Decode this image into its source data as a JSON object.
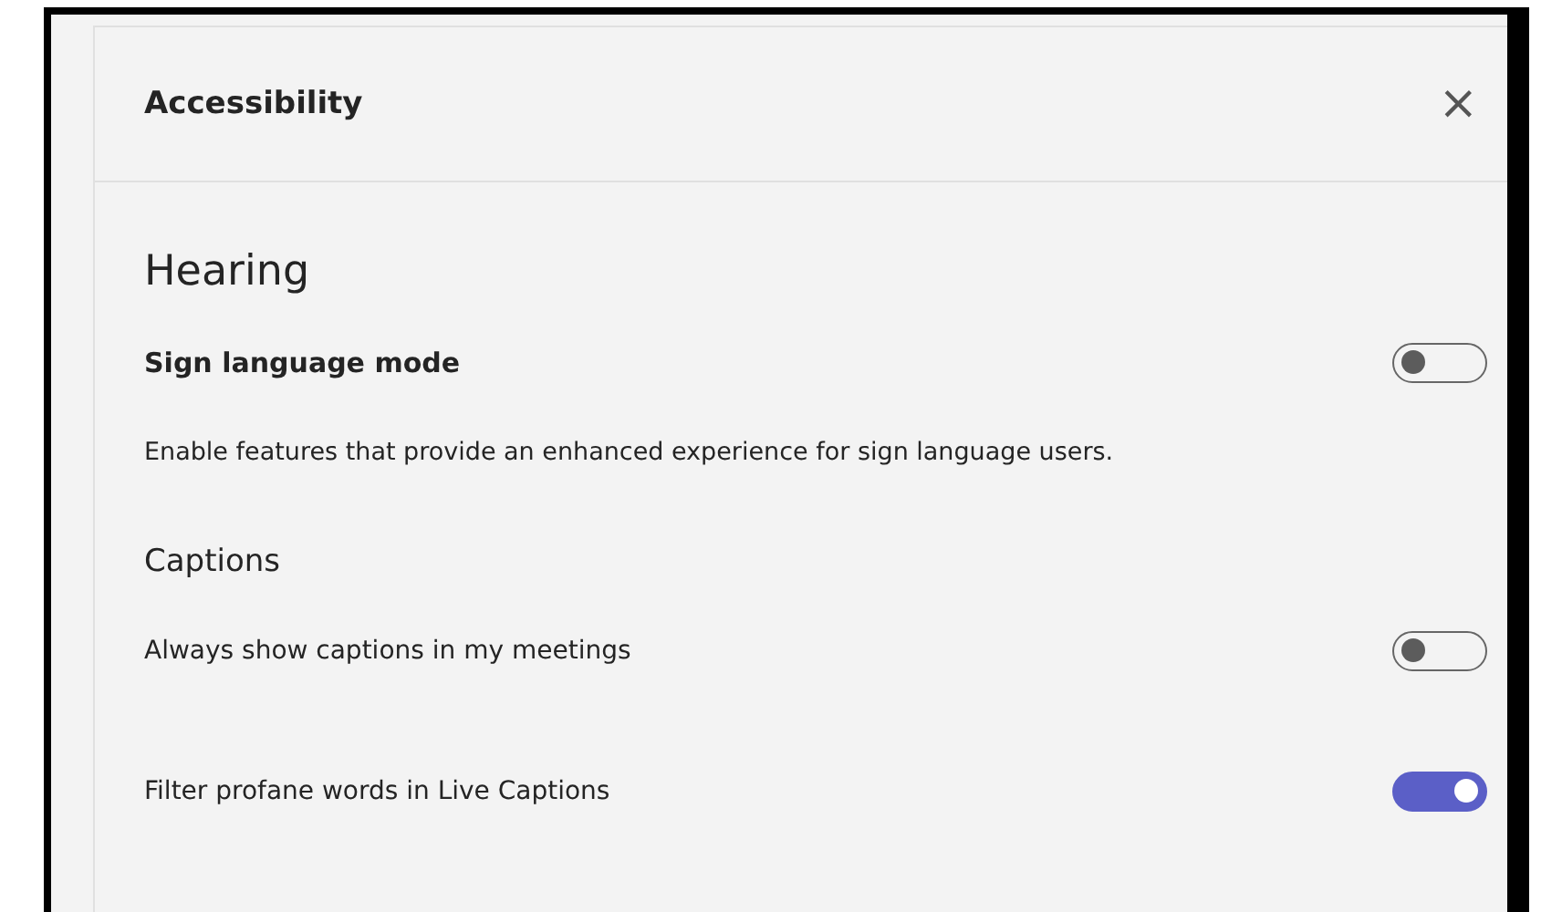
{
  "panel": {
    "title": "Accessibility",
    "close": "×"
  },
  "section": {
    "heading": "Hearing"
  },
  "items": [
    {
      "kind": "strong-toggle",
      "label": "Sign language mode",
      "on": false
    },
    {
      "kind": "description",
      "label": "Enable features that provide an enhanced experience for sign language users."
    },
    {
      "kind": "subheading",
      "label": "Captions"
    },
    {
      "kind": "toggle",
      "label": "Always show captions in my meetings",
      "on": false
    },
    {
      "kind": "toggle",
      "label": "Filter profane words in Live Captions",
      "on": true
    }
  ]
}
